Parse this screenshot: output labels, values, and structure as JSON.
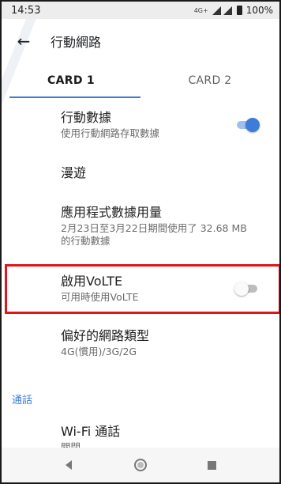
{
  "status": {
    "time": "14:53",
    "net": "4G+",
    "battery": "100%"
  },
  "appbar": {
    "title": "行動網路"
  },
  "tabs": [
    {
      "label": "CARD 1"
    },
    {
      "label": "CARD 2"
    }
  ],
  "rows": {
    "mobile_data": {
      "title": "行動數據",
      "sub": "使用行動網路存取數據",
      "toggle": "on"
    },
    "roaming": {
      "title": "漫遊"
    },
    "app_usage": {
      "title": "應用程式數據用量",
      "sub": "2月23日至3月22日期間使用了 32.68 MB 的行動數據"
    },
    "volte": {
      "title": "啟用VoLTE",
      "sub": "可用時使用VoLTE",
      "toggle": "off"
    },
    "network_type": {
      "title": "偏好的網路類型",
      "sub": "4G(慣用)/3G/2G"
    },
    "wifi_call": {
      "title": "Wi-Fi 通話",
      "sub": "關閉"
    }
  },
  "sections": {
    "calls": "通話"
  },
  "colors": {
    "accent": "#3d7dd8",
    "highlight": "#e3131b"
  }
}
